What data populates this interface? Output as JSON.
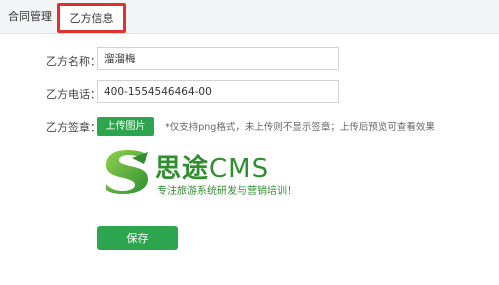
{
  "tabs": {
    "contract": "合同管理",
    "party_b": "乙方信息",
    "highlight_color": "#e03131"
  },
  "form": {
    "name_label": "乙方名称：",
    "name_value": "溜溜梅",
    "phone_label": "乙方电话：",
    "phone_value": "400-1554546464-00",
    "seal_label": "乙方签章：",
    "upload_label": "上传图片",
    "upload_hint": "*仅支持png格式，未上传则不显示签章；上传后预览可查看效果",
    "save_label": "保存"
  },
  "seal_preview": {
    "logo_main": "思途",
    "logo_cms": "CMS",
    "slogan": "专注旅游系统研发与营销培训！",
    "brand_color": "#2f8f2f"
  },
  "colors": {
    "button_green": "#2da44e"
  }
}
